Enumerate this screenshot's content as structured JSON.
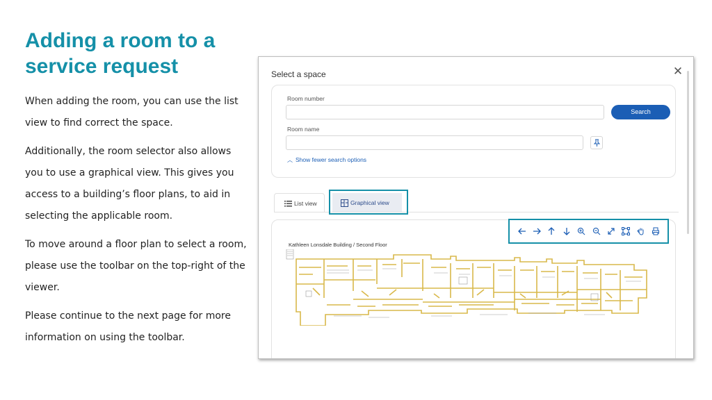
{
  "slide": {
    "title_line1": "Adding a room to a",
    "title_line2": "service request",
    "paragraphs": [
      "When adding the room, you can use the list view to find correct the space.",
      "Additionally, the room selector also allows you to use a graphical view. This gives you access to a building’s floor plans, to aid in selecting the applicable room.",
      "To move around a floor plan to select a room, please use the toolbar on the top-right of the viewer.",
      "Please continue to the next page for more information on using the toolbar."
    ]
  },
  "dialog": {
    "title": "Select a space",
    "close_glyph": "✕",
    "room_number_label": "Room number",
    "room_number_value": "",
    "room_name_label": "Room name",
    "room_name_value": "",
    "search_label": "Search",
    "fewer_options_label": "Show fewer search options",
    "tabs": {
      "list_label": "List view",
      "graphical_label": "Graphical view"
    },
    "floor_label": "Kathleen Lonsdale Building / Second Floor",
    "toolbar_icons": [
      "pan-left-icon",
      "pan-right-icon",
      "pan-up-icon",
      "pan-down-icon",
      "zoom-in-icon",
      "zoom-out-icon",
      "fit-to-view-icon",
      "select-area-icon",
      "hand-pan-icon",
      "print-icon"
    ]
  },
  "colors": {
    "accent": "#1590a8",
    "button": "#1b5eb5",
    "plan_walls": "#d9b84a"
  }
}
